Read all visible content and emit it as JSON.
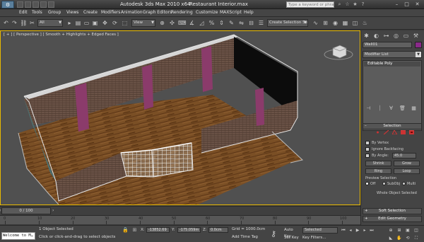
{
  "window": {
    "title": "Autodesk 3ds Max  2010 x64",
    "filename": "Restaurant Interior.max",
    "search_placeholder": "Type a keyword or phrase",
    "logo_icon": "3ds-max-logo-icon"
  },
  "menu": [
    "Edit",
    "Tools",
    "Group",
    "Views",
    "Create",
    "Modifiers",
    "Animation",
    "Graph Editors",
    "Rendering",
    "Customize",
    "MAXScript",
    "Help"
  ],
  "toolbar": {
    "selection_filter": "All",
    "ref_coord": "View",
    "named_selection": "Create Selection Se"
  },
  "viewport": {
    "label": "[ + ] [ Perspective ] [ Smooth + Highlights + Edged Faces ]"
  },
  "command_panel": {
    "object_name": "Wall01",
    "modifier_list": "Modifier List",
    "stack_item": "Editable Poly",
    "object_color": "#8a2a8a",
    "selection": {
      "title": "Selection",
      "by_vertex": "By Vertex",
      "ignore_backfacing": "Ignore Backfacing",
      "by_angle": "By Angle:",
      "angle_value": "45.0",
      "shrink": "Shrink",
      "grow": "Grow",
      "ring": "Ring",
      "loop": "Loop",
      "preview_selection": "Preview Selection",
      "off": "Off",
      "subobj": "SubObj",
      "multi": "Multi",
      "whole_object": "Whole Object Selected"
    },
    "soft_selection": "Soft Selection",
    "edit_geometry": "Edit Geometry"
  },
  "timeline": {
    "slider_label": "0 / 100",
    "ticks": [
      "0",
      "10",
      "20",
      "30",
      "40",
      "50",
      "60",
      "70",
      "80",
      "90",
      "100"
    ]
  },
  "status": {
    "listener": "Welcome to M…",
    "selection_count": "1 Object Selected",
    "prompt": "Click or click-and-drag to select objects",
    "x_label": "X:",
    "x_value": "-13852.69",
    "y_label": "Y:",
    "y_value": "-175.059m",
    "z_label": "Z:",
    "z_value": "0.0cm",
    "grid": "Grid = 1000.0cm",
    "add_time_tag": "Add Time Tag",
    "auto_key": "Auto Key",
    "set_key": "Set Key",
    "selected": "Selected",
    "key_filters": "Key Filters..."
  }
}
